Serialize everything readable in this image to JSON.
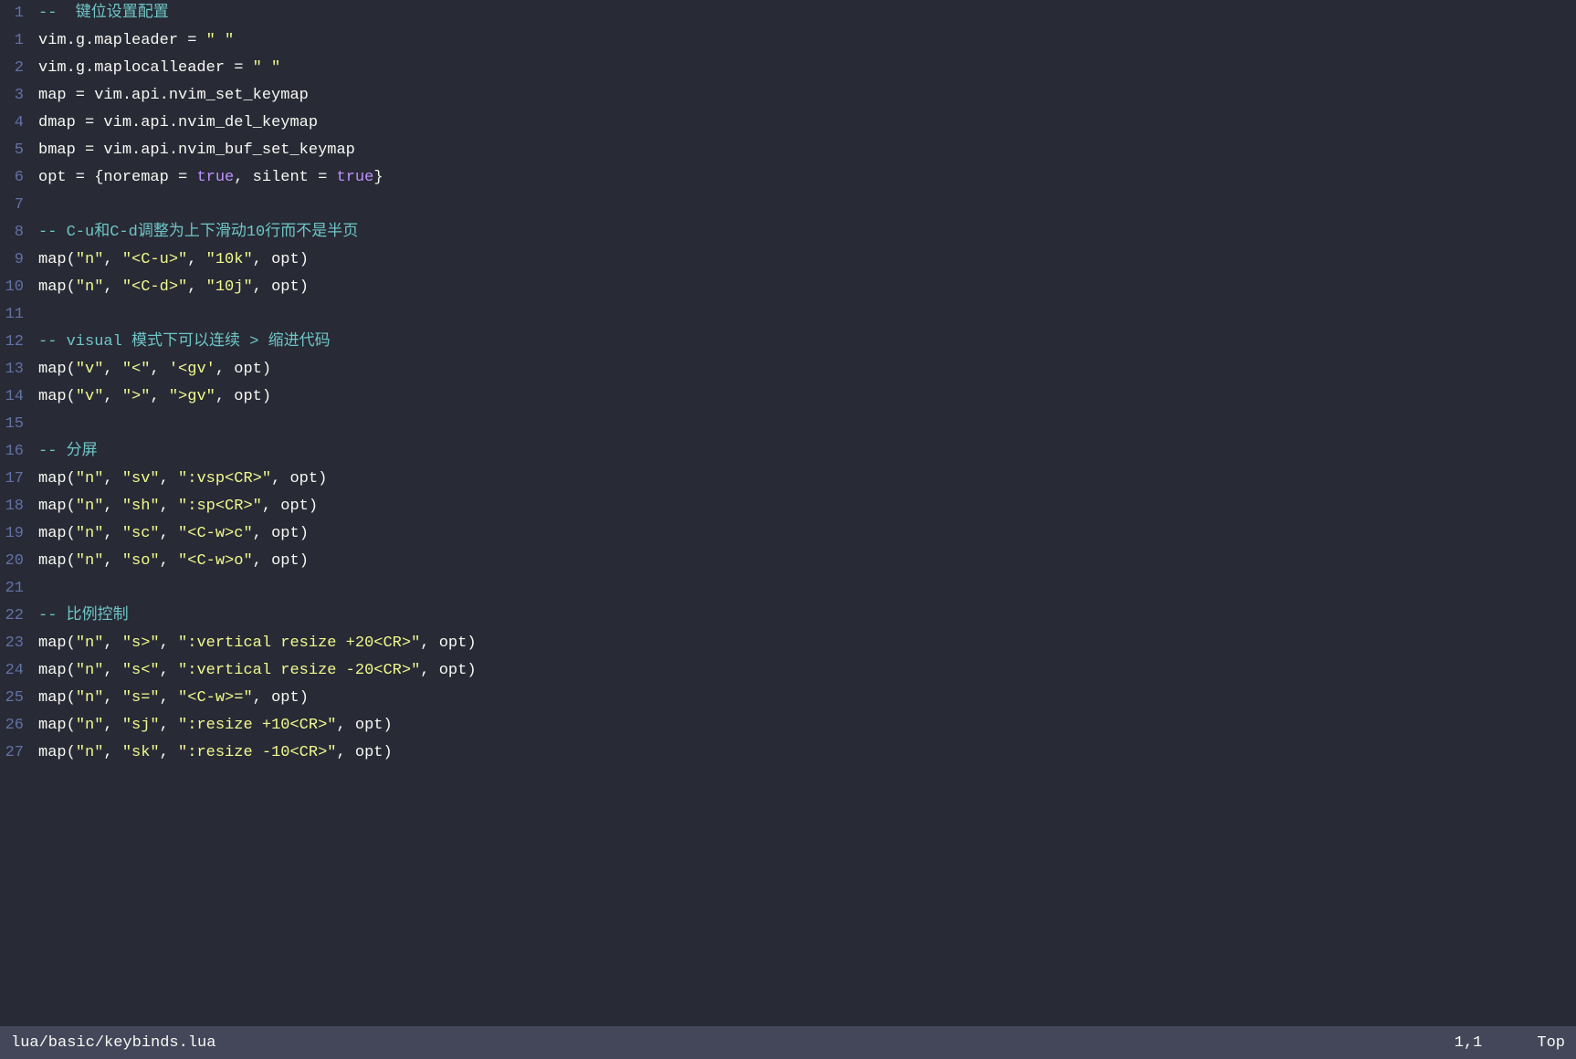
{
  "editor": {
    "filename": "lua/basic/keybinds.lua",
    "cursor_pos": "1,1",
    "scroll_pos": "Top"
  },
  "lines": [
    {
      "num": "1",
      "tokens": [
        {
          "type": "fold",
          "text": "-- "
        },
        {
          "type": "comment",
          "text": " 键位设置配置"
        }
      ]
    },
    {
      "num": "1",
      "tokens": [
        {
          "type": "var",
          "text": "vim"
        },
        {
          "type": "op",
          "text": "."
        },
        {
          "type": "var",
          "text": "g"
        },
        {
          "type": "op",
          "text": "."
        },
        {
          "type": "var",
          "text": "mapleader"
        },
        {
          "type": "op",
          "text": " = "
        },
        {
          "type": "string",
          "text": "\" \""
        }
      ]
    },
    {
      "num": "2",
      "tokens": [
        {
          "type": "var",
          "text": "vim"
        },
        {
          "type": "op",
          "text": "."
        },
        {
          "type": "var",
          "text": "g"
        },
        {
          "type": "op",
          "text": "."
        },
        {
          "type": "var",
          "text": "maplocalleader"
        },
        {
          "type": "op",
          "text": " = "
        },
        {
          "type": "string",
          "text": "\" \""
        }
      ]
    },
    {
      "num": "3",
      "tokens": [
        {
          "type": "var",
          "text": "map"
        },
        {
          "type": "op",
          "text": " = "
        },
        {
          "type": "var",
          "text": "vim"
        },
        {
          "type": "op",
          "text": "."
        },
        {
          "type": "var",
          "text": "api"
        },
        {
          "type": "op",
          "text": "."
        },
        {
          "type": "func",
          "text": "nvim_set_keymap"
        }
      ]
    },
    {
      "num": "4",
      "tokens": [
        {
          "type": "var",
          "text": "dmap"
        },
        {
          "type": "op",
          "text": " = "
        },
        {
          "type": "var",
          "text": "vim"
        },
        {
          "type": "op",
          "text": "."
        },
        {
          "type": "var",
          "text": "api"
        },
        {
          "type": "op",
          "text": "."
        },
        {
          "type": "func",
          "text": "nvim_del_keymap"
        }
      ]
    },
    {
      "num": "5",
      "tokens": [
        {
          "type": "var",
          "text": "bmap"
        },
        {
          "type": "op",
          "text": " = "
        },
        {
          "type": "var",
          "text": "vim"
        },
        {
          "type": "op",
          "text": "."
        },
        {
          "type": "var",
          "text": "api"
        },
        {
          "type": "op",
          "text": "."
        },
        {
          "type": "func",
          "text": "nvim_buf_set_keymap"
        }
      ]
    },
    {
      "num": "6",
      "tokens": [
        {
          "type": "var",
          "text": "opt"
        },
        {
          "type": "op",
          "text": " = {"
        },
        {
          "type": "var",
          "text": "noremap"
        },
        {
          "type": "op",
          "text": " = "
        },
        {
          "type": "bool",
          "text": "true"
        },
        {
          "type": "op",
          "text": ", "
        },
        {
          "type": "var",
          "text": "silent"
        },
        {
          "type": "op",
          "text": " = "
        },
        {
          "type": "bool",
          "text": "true"
        },
        {
          "type": "op",
          "text": "}"
        }
      ]
    },
    {
      "num": "7",
      "tokens": []
    },
    {
      "num": "8",
      "tokens": [
        {
          "type": "comment",
          "text": "-- C-u和C-d调整为上下滑动10行而不是半页"
        }
      ]
    },
    {
      "num": "9",
      "tokens": [
        {
          "type": "func",
          "text": "map"
        },
        {
          "type": "op",
          "text": "("
        },
        {
          "type": "string",
          "text": "\"n\""
        },
        {
          "type": "op",
          "text": ", "
        },
        {
          "type": "string",
          "text": "\"<C-u>\""
        },
        {
          "type": "op",
          "text": ", "
        },
        {
          "type": "string",
          "text": "\"10k\""
        },
        {
          "type": "op",
          "text": ", "
        },
        {
          "type": "var",
          "text": "opt"
        },
        {
          "type": "op",
          "text": ")"
        }
      ]
    },
    {
      "num": "10",
      "tokens": [
        {
          "type": "func",
          "text": "map"
        },
        {
          "type": "op",
          "text": "("
        },
        {
          "type": "string",
          "text": "\"n\""
        },
        {
          "type": "op",
          "text": ", "
        },
        {
          "type": "string",
          "text": "\"<C-d>\""
        },
        {
          "type": "op",
          "text": ", "
        },
        {
          "type": "string",
          "text": "\"10j\""
        },
        {
          "type": "op",
          "text": ", "
        },
        {
          "type": "var",
          "text": "opt"
        },
        {
          "type": "op",
          "text": ")"
        }
      ]
    },
    {
      "num": "11",
      "tokens": []
    },
    {
      "num": "12",
      "tokens": [
        {
          "type": "comment",
          "text": "-- visual 模式下可以连续 > 缩进代码"
        }
      ]
    },
    {
      "num": "13",
      "tokens": [
        {
          "type": "func",
          "text": "map"
        },
        {
          "type": "op",
          "text": "("
        },
        {
          "type": "string",
          "text": "\"v\""
        },
        {
          "type": "op",
          "text": ", "
        },
        {
          "type": "string",
          "text": "\"<\""
        },
        {
          "type": "op",
          "text": ", "
        },
        {
          "type": "string2",
          "text": "'<gv'"
        },
        {
          "type": "op",
          "text": ", "
        },
        {
          "type": "var",
          "text": "opt"
        },
        {
          "type": "op",
          "text": ")"
        }
      ]
    },
    {
      "num": "14",
      "tokens": [
        {
          "type": "func",
          "text": "map"
        },
        {
          "type": "op",
          "text": "("
        },
        {
          "type": "string",
          "text": "\"v\""
        },
        {
          "type": "op",
          "text": ", "
        },
        {
          "type": "string",
          "text": "\">\""
        },
        {
          "type": "op",
          "text": ", "
        },
        {
          "type": "string",
          "text": "\">gv\""
        },
        {
          "type": "op",
          "text": ", "
        },
        {
          "type": "var",
          "text": "opt"
        },
        {
          "type": "op",
          "text": ")"
        }
      ]
    },
    {
      "num": "15",
      "tokens": []
    },
    {
      "num": "16",
      "tokens": [
        {
          "type": "comment",
          "text": "-- 分屏"
        }
      ]
    },
    {
      "num": "17",
      "tokens": [
        {
          "type": "func",
          "text": "map"
        },
        {
          "type": "op",
          "text": "("
        },
        {
          "type": "string",
          "text": "\"n\""
        },
        {
          "type": "op",
          "text": ", "
        },
        {
          "type": "string",
          "text": "\"sv\""
        },
        {
          "type": "op",
          "text": ", "
        },
        {
          "type": "string",
          "text": "\":vsp<CR>\""
        },
        {
          "type": "op",
          "text": ", "
        },
        {
          "type": "var",
          "text": "opt"
        },
        {
          "type": "op",
          "text": ")"
        }
      ]
    },
    {
      "num": "18",
      "tokens": [
        {
          "type": "func",
          "text": "map"
        },
        {
          "type": "op",
          "text": "("
        },
        {
          "type": "string",
          "text": "\"n\""
        },
        {
          "type": "op",
          "text": ", "
        },
        {
          "type": "string",
          "text": "\"sh\""
        },
        {
          "type": "op",
          "text": ", "
        },
        {
          "type": "string",
          "text": "\":sp<CR>\""
        },
        {
          "type": "op",
          "text": ", "
        },
        {
          "type": "var",
          "text": "opt"
        },
        {
          "type": "op",
          "text": ")"
        }
      ]
    },
    {
      "num": "19",
      "tokens": [
        {
          "type": "func",
          "text": "map"
        },
        {
          "type": "op",
          "text": "("
        },
        {
          "type": "string",
          "text": "\"n\""
        },
        {
          "type": "op",
          "text": ", "
        },
        {
          "type": "string",
          "text": "\"sc\""
        },
        {
          "type": "op",
          "text": ", "
        },
        {
          "type": "string",
          "text": "\"<C-w>c\""
        },
        {
          "type": "op",
          "text": ", "
        },
        {
          "type": "var",
          "text": "opt"
        },
        {
          "type": "op",
          "text": ")"
        }
      ]
    },
    {
      "num": "20",
      "tokens": [
        {
          "type": "func",
          "text": "map"
        },
        {
          "type": "op",
          "text": "("
        },
        {
          "type": "string",
          "text": "\"n\""
        },
        {
          "type": "op",
          "text": ", "
        },
        {
          "type": "string",
          "text": "\"so\""
        },
        {
          "type": "op",
          "text": ", "
        },
        {
          "type": "string",
          "text": "\"<C-w>o\""
        },
        {
          "type": "op",
          "text": ", "
        },
        {
          "type": "var",
          "text": "opt"
        },
        {
          "type": "op",
          "text": ")"
        }
      ]
    },
    {
      "num": "21",
      "tokens": []
    },
    {
      "num": "22",
      "tokens": [
        {
          "type": "comment",
          "text": "-- 比例控制"
        }
      ]
    },
    {
      "num": "23",
      "tokens": [
        {
          "type": "func",
          "text": "map"
        },
        {
          "type": "op",
          "text": "("
        },
        {
          "type": "string",
          "text": "\"n\""
        },
        {
          "type": "op",
          "text": ", "
        },
        {
          "type": "string",
          "text": "\"s>\""
        },
        {
          "type": "op",
          "text": ", "
        },
        {
          "type": "string",
          "text": "\":vertical resize +20<CR>\""
        },
        {
          "type": "op",
          "text": ", "
        },
        {
          "type": "var",
          "text": "opt"
        },
        {
          "type": "op",
          "text": ")"
        }
      ]
    },
    {
      "num": "24",
      "tokens": [
        {
          "type": "func",
          "text": "map"
        },
        {
          "type": "op",
          "text": "("
        },
        {
          "type": "string",
          "text": "\"n\""
        },
        {
          "type": "op",
          "text": ", "
        },
        {
          "type": "string",
          "text": "\"s<\""
        },
        {
          "type": "op",
          "text": ", "
        },
        {
          "type": "string",
          "text": "\":vertical resize -20<CR>\""
        },
        {
          "type": "op",
          "text": ", "
        },
        {
          "type": "var",
          "text": "opt"
        },
        {
          "type": "op",
          "text": ")"
        }
      ]
    },
    {
      "num": "25",
      "tokens": [
        {
          "type": "func",
          "text": "map"
        },
        {
          "type": "op",
          "text": "("
        },
        {
          "type": "string",
          "text": "\"n\""
        },
        {
          "type": "op",
          "text": ", "
        },
        {
          "type": "string",
          "text": "\"s=\""
        },
        {
          "type": "op",
          "text": ", "
        },
        {
          "type": "string",
          "text": "\"<C-w>=\""
        },
        {
          "type": "op",
          "text": ", "
        },
        {
          "type": "var",
          "text": "opt"
        },
        {
          "type": "op",
          "text": ")"
        }
      ]
    },
    {
      "num": "26",
      "tokens": [
        {
          "type": "func",
          "text": "map"
        },
        {
          "type": "op",
          "text": "("
        },
        {
          "type": "string",
          "text": "\"n\""
        },
        {
          "type": "op",
          "text": ", "
        },
        {
          "type": "string",
          "text": "\"sj\""
        },
        {
          "type": "op",
          "text": ", "
        },
        {
          "type": "string",
          "text": "\":resize +10<CR>\""
        },
        {
          "type": "op",
          "text": ", "
        },
        {
          "type": "var",
          "text": "opt"
        },
        {
          "type": "op",
          "text": ")"
        }
      ]
    },
    {
      "num": "27",
      "tokens": [
        {
          "type": "func",
          "text": "map"
        },
        {
          "type": "op",
          "text": "("
        },
        {
          "type": "string",
          "text": "\"n\""
        },
        {
          "type": "op",
          "text": ", "
        },
        {
          "type": "string",
          "text": "\"sk\""
        },
        {
          "type": "op",
          "text": ", "
        },
        {
          "type": "string",
          "text": "\":resize -10<CR>\""
        },
        {
          "type": "op",
          "text": ", "
        },
        {
          "type": "var",
          "text": "opt"
        },
        {
          "type": "op",
          "text": ")"
        }
      ]
    }
  ],
  "display_line_numbers": [
    "1",
    "1",
    "2",
    "3",
    "4",
    "5",
    "6",
    "7",
    "8",
    "9",
    "10",
    "11",
    "12",
    "13",
    "14",
    "15",
    "16",
    "17",
    "18",
    "19",
    "20",
    "21",
    "22",
    "23",
    "24",
    "25",
    "26",
    "27"
  ]
}
